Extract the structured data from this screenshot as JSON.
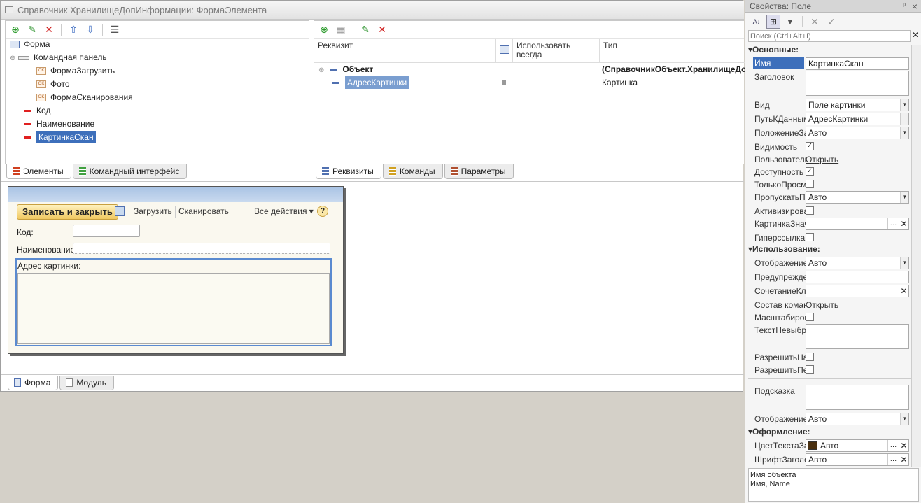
{
  "window": {
    "title": "Справочник ХранилищеДопИнформации: ФормаЭлемента"
  },
  "elements_tree": {
    "items": [
      {
        "label": "Форма",
        "type": "form"
      },
      {
        "label": "Командная панель",
        "type": "panel"
      },
      {
        "label": "ФормаЗагрузить",
        "type": "button"
      },
      {
        "label": "Фото",
        "type": "button"
      },
      {
        "label": "ФормаСканирования",
        "type": "button"
      },
      {
        "label": "Код",
        "type": "field"
      },
      {
        "label": "Наименование",
        "type": "field"
      },
      {
        "label": "КартинкаСкан",
        "type": "field"
      }
    ],
    "tabs": [
      "Элементы",
      "Командный интерфейс"
    ]
  },
  "attributes": {
    "columns": [
      "Реквизит",
      "Использовать всегда",
      "Тип"
    ],
    "rows": [
      {
        "name": "Объект",
        "type": "(СправочникОбъект.ХранилищеДо"
      },
      {
        "name": "АдресКартинки",
        "type": "Картинка"
      }
    ],
    "tabs": [
      "Реквизиты",
      "Команды",
      "Параметры"
    ]
  },
  "preview": {
    "save_close": "Записать и закрыть",
    "load": "Загрузить",
    "scan": "Сканировать",
    "all_actions": "Все действия ▾",
    "help": "?",
    "code_label": "Код:",
    "name_label": "Наименование:",
    "address_label": "Адрес картинки:"
  },
  "bottom_tabs": [
    "Форма",
    "Модуль"
  ],
  "props": {
    "title": "Свойства: Поле",
    "pin": "ᵖ",
    "close": "×",
    "search_placeholder": "Поиск (Ctrl+Alt+I)",
    "sections": {
      "main": "Основные:",
      "usage": "Использование:",
      "design": "Оформление:"
    },
    "rows": {
      "name": {
        "label": "Имя",
        "value": "КартинкаСкан"
      },
      "title": {
        "label": "Заголовок",
        "value": ""
      },
      "view": {
        "label": "Вид",
        "value": "Поле картинки"
      },
      "datapath": {
        "label": "ПутьКДанным",
        "value": "АдресКартинки"
      },
      "titlepos": {
        "label": "ПоложениеЗаголовка",
        "value": "Авто"
      },
      "visible": {
        "label": "Видимость"
      },
      "user": {
        "label": "Пользовательская",
        "link": "Открыть"
      },
      "enabled": {
        "label": "Доступность"
      },
      "readonly": {
        "label": "ТолькоПросмотр"
      },
      "skip": {
        "label": "ПропускатьПриВводе",
        "value": "Авто"
      },
      "activate": {
        "label": "Активизировать"
      },
      "picvalues": {
        "label": "КартинкаЗначений",
        "value": ""
      },
      "hyperlink": {
        "label": "Гиперссылка"
      },
      "display": {
        "label": "Отображение",
        "value": "Авто"
      },
      "warning": {
        "label": "Предупреждение",
        "value": ""
      },
      "shortcut": {
        "label": "СочетаниеКлавиш",
        "value": ""
      },
      "commands": {
        "label": "Состав команд",
        "link": "Открыть"
      },
      "scale": {
        "label": "Масштабировать"
      },
      "noselect": {
        "label": "ТекстНевыбранной",
        "value": ""
      },
      "allow1": {
        "label": "РазрешитьНачало"
      },
      "allow2": {
        "label": "РазрешитьПеретаскивание"
      },
      "hint": {
        "label": "Подсказка",
        "value": ""
      },
      "display2": {
        "label": "Отображение",
        "value": "Авто"
      },
      "textcolor": {
        "label": "ЦветТекстаЗаголовка",
        "value": "Авто"
      },
      "font": {
        "label": "ШрифтЗаголовка",
        "value": "Авто"
      }
    },
    "footer_line1": "Имя объекта",
    "footer_line2": "Имя, Name"
  }
}
